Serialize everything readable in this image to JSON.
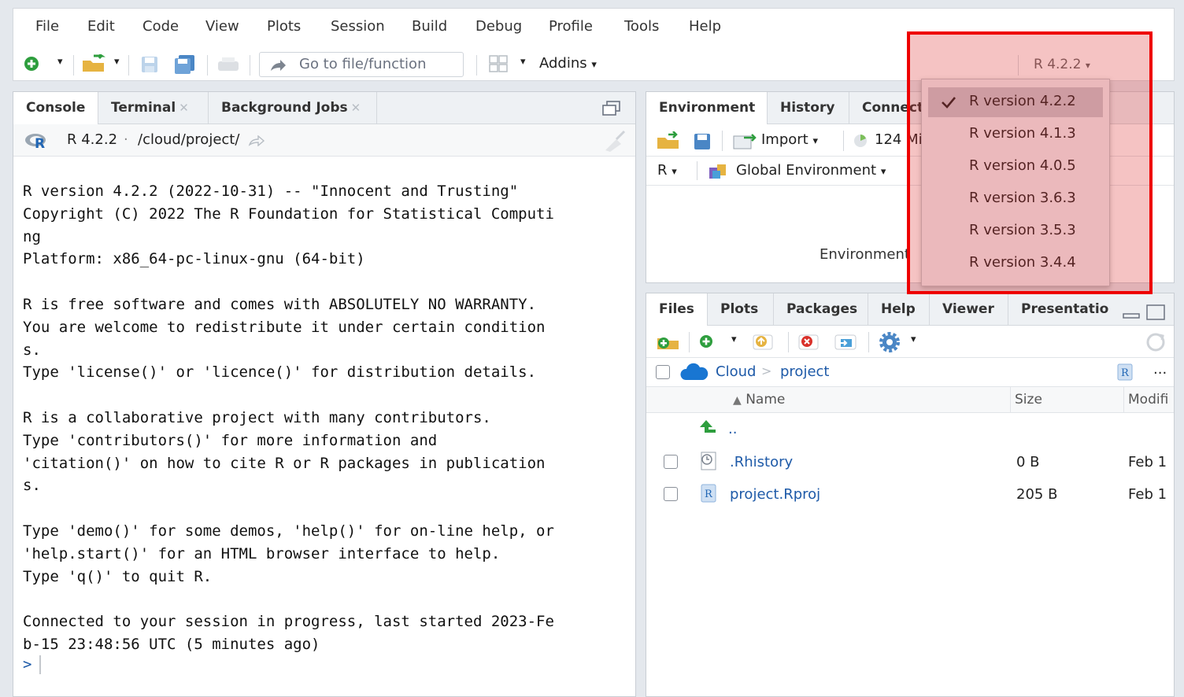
{
  "menu": [
    "File",
    "Edit",
    "Code",
    "View",
    "Plots",
    "Session",
    "Build",
    "Debug",
    "Profile",
    "Tools",
    "Help"
  ],
  "toolbar": {
    "goto_placeholder": "Go to file/function",
    "addins_label": "Addins",
    "r_version_label": "R 4.2.2"
  },
  "left_pane": {
    "tabs": [
      "Console",
      "Terminal",
      "Background Jobs"
    ],
    "path_version": "R 4.2.2",
    "path_sep": "·",
    "path": "/cloud/project/",
    "console_lines": [
      "R version 4.2.2 (2022-10-31) -- \"Innocent and Trusting\"",
      "Copyright (C) 2022 The R Foundation for Statistical Computi",
      "ng",
      "Platform: x86_64-pc-linux-gnu (64-bit)",
      "",
      "R is free software and comes with ABSOLUTELY NO WARRANTY.",
      "You are welcome to redistribute it under certain condition",
      "s.",
      "Type 'license()' or 'licence()' for distribution details.",
      "",
      "R is a collaborative project with many contributors.",
      "Type 'contributors()' for more information and",
      "'citation()' on how to cite R or R packages in publication",
      "s.",
      "",
      "Type 'demo()' for some demos, 'help()' for on-line help, or",
      "'help.start()' for an HTML browser interface to help.",
      "Type 'q()' to quit R.",
      "",
      "Connected to your session in progress, last started 2023-Fe",
      "b-15 23:48:56 UTC (5 minutes ago)"
    ],
    "prompt": ">"
  },
  "env_pane": {
    "tabs": [
      "Environment",
      "History",
      "Connect"
    ],
    "import_label": "Import",
    "memory_label": "124 Mi",
    "lang_label": "R",
    "scope_label": "Global Environment",
    "empty_text": "Environment"
  },
  "version_menu": {
    "items": [
      "R version 4.2.2",
      "R version 4.1.3",
      "R version 4.0.5",
      "R version 3.6.3",
      "R version 3.5.3",
      "R version 3.4.4"
    ],
    "selected_index": 0
  },
  "files_pane": {
    "tabs": [
      "Files",
      "Plots",
      "Packages",
      "Help",
      "Viewer",
      "Presentatio"
    ],
    "breadcrumb": [
      "Cloud",
      "project"
    ],
    "breadcrumb_sep": ">",
    "more_label": "...",
    "columns": {
      "name": "Name",
      "size": "Size",
      "modified": "Modifi"
    },
    "sort_arrow": "▲",
    "parent_dir": "..",
    "files": [
      {
        "name": ".Rhistory",
        "size": "0 B",
        "modified": "Feb 1"
      },
      {
        "name": "project.Rproj",
        "size": "205 B",
        "modified": "Feb 1"
      }
    ]
  },
  "colors": {
    "highlight": "#ee0000",
    "link": "#1e5aa8",
    "selected_item_bg": "#c9c9d2"
  }
}
